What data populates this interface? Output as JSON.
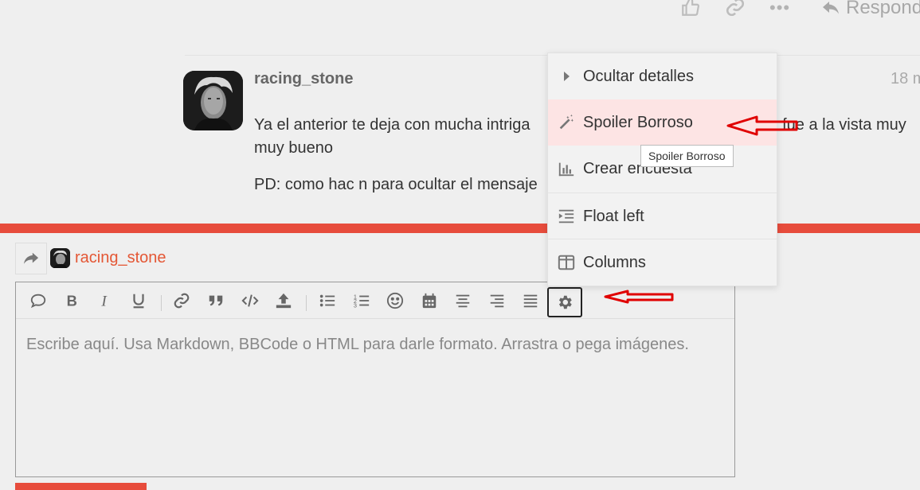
{
  "post_actions": {
    "reply_label": "Responder"
  },
  "post": {
    "username": "racing_stone",
    "date": "18 m",
    "paragraphs": [
      "Ya el anterior te deja con mucha intriga",
      "; fue a la vista muy",
      "muy bueno",
      "PD: como hac n para ocultar el mensaje"
    ]
  },
  "composer": {
    "reply_to_username": "racing_stone",
    "placeholder": "Escribe aquí. Usa Markdown, BBCode o HTML para darle formato. Arrastra o pega imágenes.",
    "toolbar_icons": [
      "quote-icon",
      "bold-icon",
      "italic-icon",
      "underline-icon",
      "link-icon",
      "blockquote-icon",
      "code-icon",
      "upload-icon",
      "bullet-list-icon",
      "numbered-list-icon",
      "emoji-icon",
      "calendar-icon",
      "align-center-icon",
      "align-right-icon",
      "justify-icon",
      "gear-icon"
    ]
  },
  "menu": {
    "items": [
      {
        "label": "Ocultar detalles",
        "icon": "caret-right-icon"
      },
      {
        "label": "Spoiler Borroso",
        "icon": "magic-wand-icon"
      },
      {
        "label": "Crear encuesta",
        "icon": "chart-bar-icon"
      },
      {
        "label": "Float left",
        "icon": "indent-icon"
      },
      {
        "label": "Columns",
        "icon": "columns-icon"
      }
    ],
    "tooltip": "Spoiler Borroso"
  },
  "colors": {
    "accent": "#e74c3c",
    "username_accent": "#e45735",
    "highlight": "#fde4e4",
    "annotation_arrow": "#e00000"
  }
}
